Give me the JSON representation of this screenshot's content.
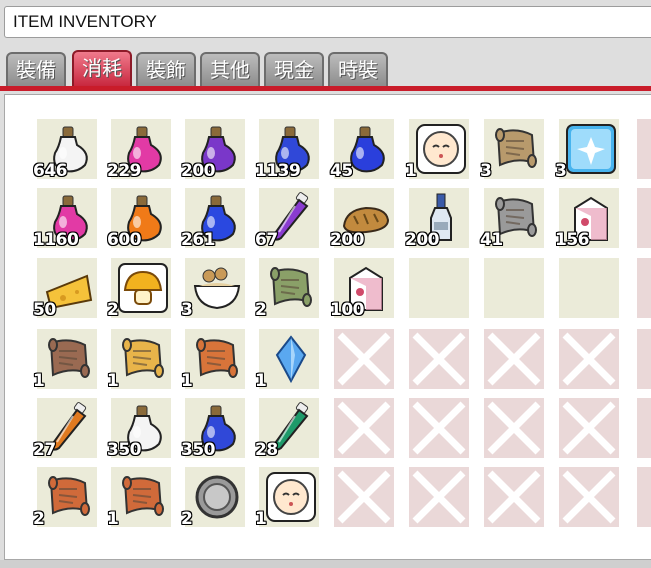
{
  "window": {
    "title": "ITEM INVENTORY"
  },
  "tabs": [
    {
      "label": "裝備",
      "active": false
    },
    {
      "label": "消耗",
      "active": true
    },
    {
      "label": "裝飾",
      "active": false
    },
    {
      "label": "其他",
      "active": false
    },
    {
      "label": "現金",
      "active": false
    },
    {
      "label": "時裝",
      "active": false
    }
  ],
  "colors": {
    "active_tab": "#dc3a52",
    "accent_line": "#c91c2a",
    "slot_bg": "#ebebd9",
    "locked_bg": "#ead8d8"
  },
  "rows": [
    [
      {
        "icon": "white-potion-icon",
        "qty": "646",
        "kind": "potion",
        "color": "#f4f4f4"
      },
      {
        "icon": "pink-potion-icon",
        "qty": "229",
        "kind": "potion",
        "color": "#e23aa5"
      },
      {
        "icon": "purple-potion-icon",
        "qty": "200",
        "kind": "potion",
        "color": "#7a37c9"
      },
      {
        "icon": "mana-elixir-icon",
        "qty": "1139",
        "kind": "potion",
        "color": "#3048d8"
      },
      {
        "icon": "blue-potion-icon",
        "qty": "45",
        "kind": "potion",
        "color": "#2a3fdc"
      },
      {
        "icon": "face-icon",
        "qty": "1",
        "kind": "face",
        "color": "#ffe8cf"
      },
      {
        "icon": "map-scroll-icon",
        "qty": "3",
        "kind": "scroll",
        "color": "#b89a6c"
      },
      {
        "icon": "sparkle-ticket-icon",
        "qty": "3",
        "kind": "ticket",
        "color": "#48b4ee"
      },
      {
        "kind": "none"
      },
      {
        "kind": "none"
      }
    ],
    [
      {
        "icon": "pink-potion-icon",
        "qty": "1160",
        "kind": "potion",
        "color": "#e23aa5"
      },
      {
        "icon": "orange-potion-icon",
        "qty": "600",
        "kind": "potion",
        "color": "#f07a18"
      },
      {
        "icon": "blue-potion-icon",
        "qty": "261",
        "kind": "potion",
        "color": "#2a48e0"
      },
      {
        "icon": "purple-vial-icon",
        "qty": "67",
        "kind": "vial",
        "color": "#8a3cd0"
      },
      {
        "icon": "bread-icon",
        "qty": "200",
        "kind": "bread",
        "color": "#c28a3e"
      },
      {
        "icon": "water-bottle-icon",
        "qty": "200",
        "kind": "bottle",
        "color": "#dfe8f2"
      },
      {
        "icon": "grey-scroll-icon",
        "qty": "41",
        "kind": "scroll",
        "color": "#9a9a9a"
      },
      {
        "icon": "milk-carton-icon",
        "qty": "156",
        "kind": "milk",
        "color": "#e8a0b8"
      },
      {
        "kind": "none"
      },
      {
        "kind": "none"
      }
    ],
    [
      {
        "icon": "cheese-icon",
        "qty": "50",
        "kind": "cheese",
        "color": "#f5c23a"
      },
      {
        "icon": "golden-mushroom-icon",
        "qty": "2",
        "kind": "mushroom",
        "color": "#f2b21f"
      },
      {
        "icon": "noodle-bowl-icon",
        "qty": "3",
        "kind": "bowl",
        "color": "#c99a58"
      },
      {
        "icon": "green-scroll-icon",
        "qty": "2",
        "kind": "scroll",
        "color": "#8aa068"
      },
      {
        "icon": "milk-carton-icon",
        "qty": "100",
        "kind": "milk",
        "color": "#e8a0b8"
      },
      {
        "kind": "empty"
      },
      {
        "kind": "empty"
      },
      {
        "kind": "empty"
      },
      {
        "kind": "none"
      },
      {
        "kind": "none"
      }
    ],
    [
      {
        "icon": "skull-scroll-icon",
        "qty": "1",
        "kind": "scroll",
        "color": "#9a6a52"
      },
      {
        "icon": "yellow-scroll-icon",
        "qty": "1",
        "kind": "scroll",
        "color": "#e8b44a"
      },
      {
        "icon": "orange-scroll-icon",
        "qty": "1",
        "kind": "scroll",
        "color": "#d8743a"
      },
      {
        "icon": "blue-crystal-icon",
        "qty": "1",
        "kind": "crystal",
        "color": "#5aa8f0"
      },
      {
        "kind": "locked"
      },
      {
        "kind": "locked"
      },
      {
        "kind": "locked"
      },
      {
        "kind": "locked"
      },
      {
        "kind": "none"
      },
      {
        "kind": "none"
      }
    ],
    [
      {
        "icon": "orange-vial-icon",
        "qty": "27",
        "kind": "vial",
        "color": "#e07a20"
      },
      {
        "icon": "white-potion-icon",
        "qty": "350",
        "kind": "potion",
        "color": "#f4f4f4"
      },
      {
        "icon": "mana-elixir-icon",
        "qty": "350",
        "kind": "potion",
        "color": "#3048d8"
      },
      {
        "icon": "green-vial-icon",
        "qty": "28",
        "kind": "vial",
        "color": "#1e9a6a"
      },
      {
        "kind": "locked"
      },
      {
        "kind": "locked"
      },
      {
        "kind": "locked"
      },
      {
        "kind": "locked"
      },
      {
        "kind": "none"
      },
      {
        "kind": "none"
      }
    ],
    [
      {
        "icon": "red-scroll-icon",
        "qty": "2",
        "kind": "scroll",
        "color": "#d06a3a"
      },
      {
        "icon": "red-scroll-icon",
        "qty": "1",
        "kind": "scroll",
        "color": "#d06a3a"
      },
      {
        "icon": "silver-coin-icon",
        "qty": "2",
        "kind": "coin",
        "color": "#9a9a9a"
      },
      {
        "icon": "face-icon",
        "qty": "1",
        "kind": "face",
        "color": "#ffe8cf"
      },
      {
        "kind": "locked"
      },
      {
        "kind": "locked"
      },
      {
        "kind": "locked"
      },
      {
        "kind": "locked"
      },
      {
        "kind": "none"
      },
      {
        "kind": "none"
      }
    ]
  ]
}
